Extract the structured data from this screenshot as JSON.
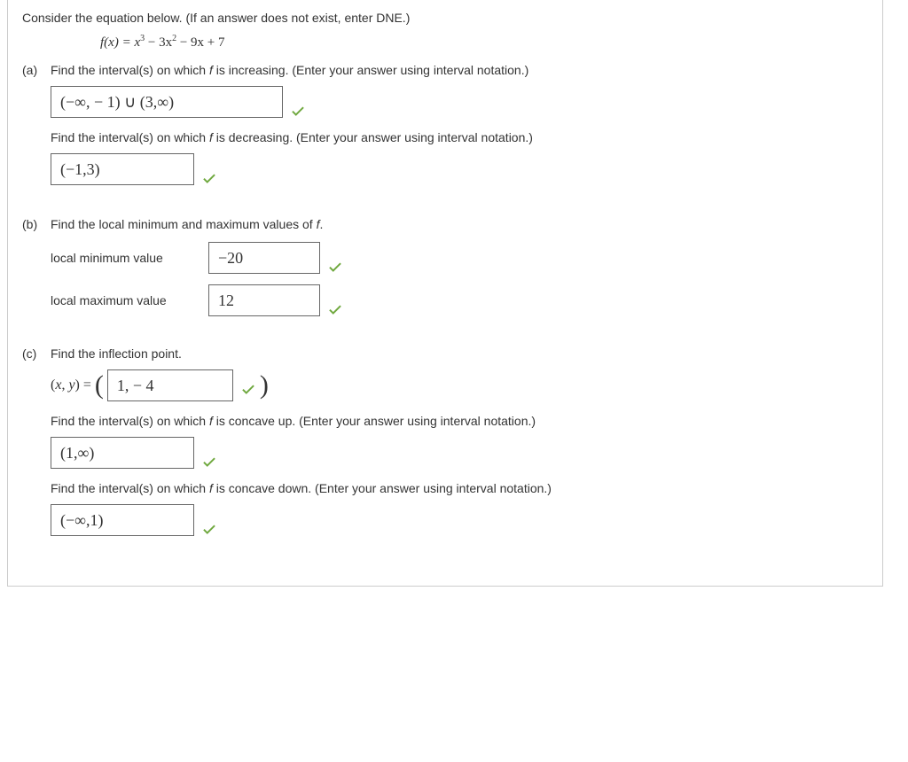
{
  "intro": "Consider the equation below. (If an answer does not exist, enter DNE.)",
  "equation_parts": {
    "lhs": "f(x) = x",
    "p1": "3",
    "m1": " − 3x",
    "p2": "2",
    "m2": " − 9x + 7"
  },
  "a": {
    "label": "(a)",
    "prompt1": "Find the interval(s) on which f is increasing. (Enter your answer using interval notation.)",
    "answer1": "(−∞, − 1) ∪ (3,∞)",
    "prompt2": "Find the interval(s) on which f is decreasing. (Enter your answer using interval notation.)",
    "answer2": "(−1,3)"
  },
  "b": {
    "label": "(b)",
    "prompt": "Find the local minimum and maximum values of f.",
    "min_label": "local minimum value",
    "min_value": "−20",
    "max_label": "local maximum value",
    "max_value": "12"
  },
  "c": {
    "label": "(c)",
    "prompt": "Find the inflection point.",
    "xy_label": "(x, y) = ",
    "inflection_value": "1, − 4",
    "prompt_up": "Find the interval(s) on which f is concave up. (Enter your answer using interval notation.)",
    "answer_up": "(1,∞)",
    "prompt_down": "Find the interval(s) on which f is concave down. (Enter your answer using interval notation.)",
    "answer_down": "(−∞,1)"
  }
}
